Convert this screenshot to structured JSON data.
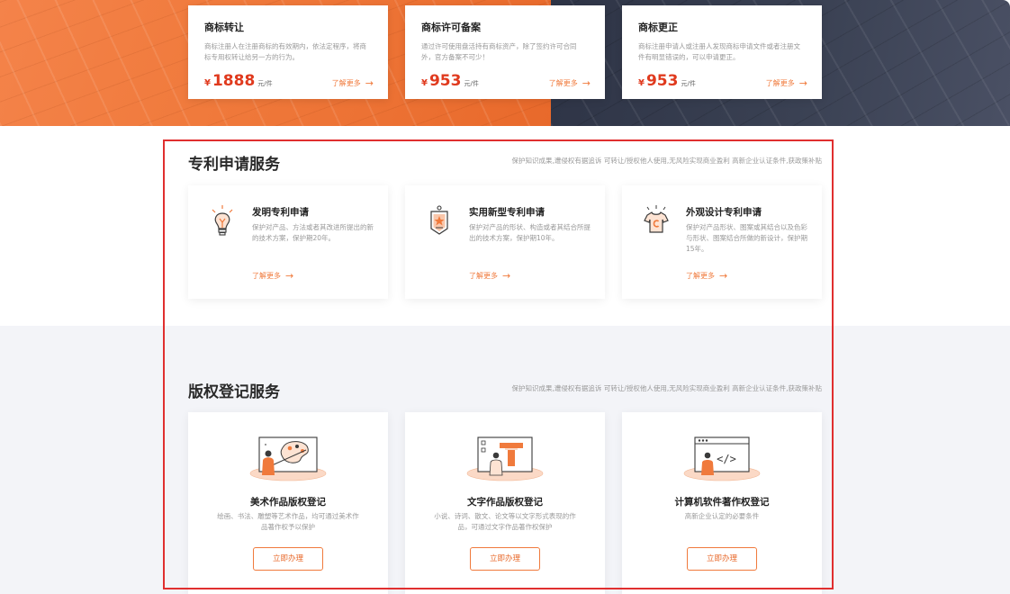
{
  "trademark_cards": [
    {
      "title": "商标转让",
      "desc": "商标注册人在注册商标的有效期内，依法定程序，将商标专用权转让给另一方的行为。",
      "currency": "¥",
      "price": "1888",
      "unit": "元/件",
      "more": "了解更多",
      "arrow": "→"
    },
    {
      "title": "商标许可备案",
      "desc": "通过许可使用盘活持有商标资产，除了签约许可合同外，官方备案不可少！",
      "currency": "¥",
      "price": "953",
      "unit": "元/件",
      "more": "了解更多",
      "arrow": "→"
    },
    {
      "title": "商标更正",
      "desc": "商标注册申请人或注册人发现商标申请文件或者注册文件有明显错误的，可以申请更正。",
      "currency": "¥",
      "price": "953",
      "unit": "元/件",
      "more": "了解更多",
      "arrow": "→"
    }
  ],
  "patent_section": {
    "title": "专利申请服务",
    "subtitle": "保护知识成果,遭侵权有据追诉 可转让/授权他人使用,无风险实现商业盈利 高新企业认证条件,获政策补贴",
    "cards": [
      {
        "title": "发明专利申请",
        "desc": "保护对产品、方法或者其改进所提出的新的技术方案，保护期20年。",
        "more": "了解更多",
        "arrow": "→",
        "icon": "lightbulb-icon"
      },
      {
        "title": "实用新型专利申请",
        "desc": "保护对产品的形状、构造或者其结合所提出的技术方案，保护期10年。",
        "more": "了解更多",
        "arrow": "→",
        "icon": "badge-icon"
      },
      {
        "title": "外观设计专利申请",
        "desc": "保护对产品形状、图案或其结合以及色彩与形状、图案结合所做的新设计，保护期15年。",
        "more": "了解更多",
        "arrow": "→",
        "icon": "shirt-icon"
      }
    ]
  },
  "copyright_section": {
    "title": "版权登记服务",
    "subtitle": "保护知识成果,遭侵权有据追诉 可转让/授权他人使用,无风险实现商业盈利 高新企业认证条件,获政策补贴",
    "cards": [
      {
        "title": "美术作品版权登记",
        "desc": "绘画、书法、雕塑等艺术作品，均可通过美术作品著作权予以保护",
        "button": "立即办理",
        "icon": "art-palette-illustration"
      },
      {
        "title": "文字作品版权登记",
        "desc": "小说、诗词、散文、论文等以文字形式表现的作品，可通过文字作品著作权保护",
        "button": "立即办理",
        "icon": "text-document-illustration"
      },
      {
        "title": "计算机软件著作权登记",
        "desc": "高新企业认定的必要条件",
        "button": "立即办理",
        "icon": "code-window-illustration"
      }
    ]
  },
  "colors": {
    "accent": "#f07a3c",
    "price": "#e03a1e",
    "highlight": "#e02f2f",
    "dark_band": "#2e3446"
  }
}
